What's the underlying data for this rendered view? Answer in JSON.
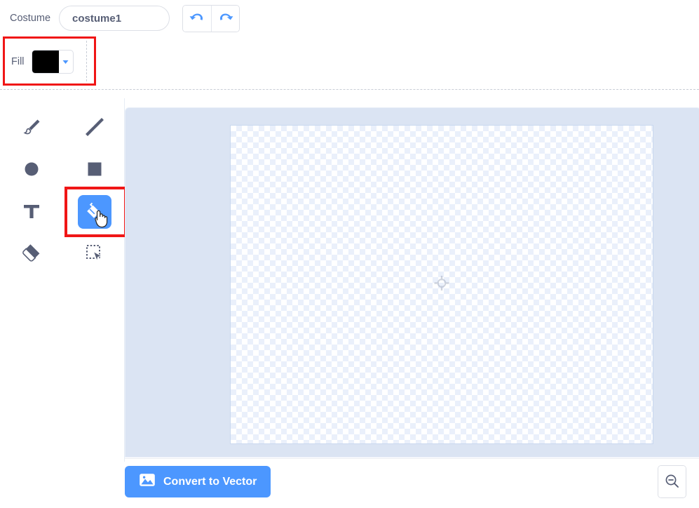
{
  "header": {
    "costume_label": "Costume",
    "costume_name_value": "costume1",
    "costume_name_placeholder": "costume1",
    "undo_label": "undo",
    "redo_label": "redo"
  },
  "fill_toolbar": {
    "fill_label": "Fill",
    "fill_color_hex": "#000000",
    "caret_label": "▾"
  },
  "tools": [
    {
      "name": "brush-tool",
      "label": "Brush",
      "selected": false
    },
    {
      "name": "line-tool",
      "label": "Line",
      "selected": false
    },
    {
      "name": "circle-tool",
      "label": "Circle",
      "selected": false
    },
    {
      "name": "rect-tool",
      "label": "Rectangle",
      "selected": false
    },
    {
      "name": "text-tool",
      "label": "Text",
      "selected": false
    },
    {
      "name": "fill-tool",
      "label": "Fill",
      "selected": true
    },
    {
      "name": "eraser-tool",
      "label": "Eraser",
      "selected": false
    },
    {
      "name": "select-tool",
      "label": "Select",
      "selected": false
    }
  ],
  "canvas": {
    "center_marker_label": "canvas center",
    "background": "transparent checkerboard"
  },
  "bottom_bar": {
    "convert_button_label": "Convert to Vector",
    "zoom_out_label": "Zoom out"
  },
  "highlights": [
    {
      "name": "fill-color-highlight",
      "color": "#f01616"
    },
    {
      "name": "fill-tool-highlight",
      "color": "#f01616"
    }
  ],
  "colors": {
    "accent_blue": "#4c97ff",
    "text_gray": "#575e75",
    "workspace_blue": "#dbe4f3",
    "highlight_red": "#f01616"
  }
}
